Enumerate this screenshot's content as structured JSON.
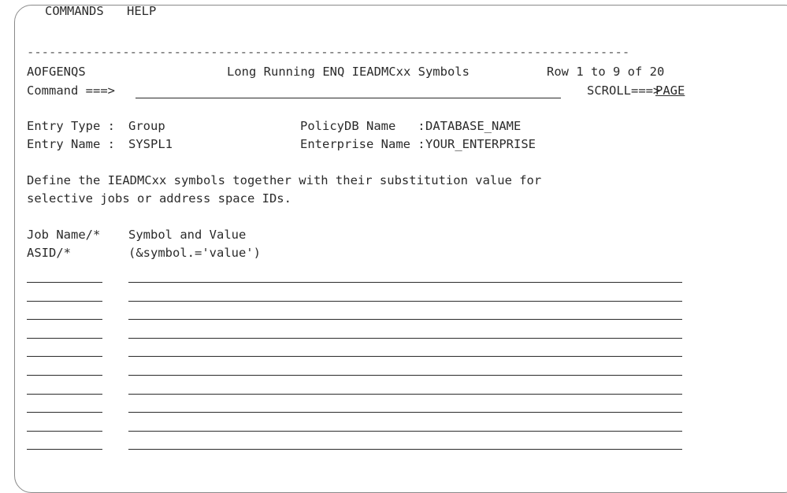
{
  "menu": {
    "commands": "COMMANDS",
    "help": "HELP"
  },
  "header": {
    "separator": "----------------------------------------------------------------------------------",
    "panel_id": "AOFGENQS",
    "title": "Long Running ENQ IEADMCxx Symbols",
    "row_info": "Row 1 to 9 of 20",
    "command_label": "Command ===>",
    "command_value": "",
    "scroll_label": "SCROLL===>",
    "scroll_value": "PAGE"
  },
  "entry": {
    "type_label": "Entry Type :",
    "type_value": "Group",
    "name_label": "Entry Name :",
    "name_value": "SYSPL1",
    "policydb_label": "PolicyDB Name   :",
    "policydb_value": "DATABASE_NAME",
    "enterprise_label": "Enterprise Name :",
    "enterprise_value": "YOUR_ENTERPRISE"
  },
  "description": {
    "line1": "Define the IEADMCxx symbols together with their substitution value for",
    "line2": "selective jobs or address space IDs."
  },
  "columns": {
    "job_line1": "Job Name/*",
    "job_line2": "ASID/*",
    "symbol_line1": "Symbol and Value",
    "symbol_line2": "(&symbol.='value')"
  },
  "rows": [
    {
      "job": "",
      "symbol": ""
    },
    {
      "job": "",
      "symbol": ""
    },
    {
      "job": "",
      "symbol": ""
    },
    {
      "job": "",
      "symbol": ""
    },
    {
      "job": "",
      "symbol": ""
    },
    {
      "job": "",
      "symbol": ""
    },
    {
      "job": "",
      "symbol": ""
    },
    {
      "job": "",
      "symbol": ""
    },
    {
      "job": "",
      "symbol": ""
    },
    {
      "job": "",
      "symbol": ""
    }
  ]
}
